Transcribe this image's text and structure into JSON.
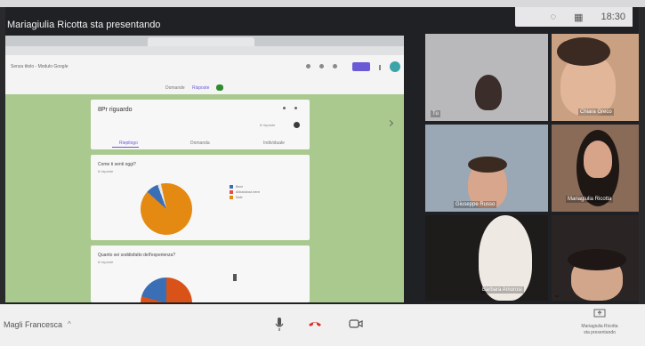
{
  "window": {
    "presenter_title": "Mariagiulia Ricotta sta presentando",
    "clock": "18:30"
  },
  "shared_screen": {
    "forms_title": "Senza titolo - Modulo Google",
    "tab_questions": "Domande",
    "tab_answers": "Risposte",
    "summary": {
      "title": "8Pr riguardo",
      "count": "8 risposte",
      "tabs": [
        "Riepilogo",
        "Domanda",
        "Individuale"
      ]
    },
    "question1": {
      "title": "Come ti senti oggi?",
      "subtitle": "8 risposte",
      "legend": [
        "Bene",
        "Abbastanza bene",
        "Male"
      ]
    },
    "question2": {
      "title": "Quanto sei soddisfatto dell'esperienza?",
      "subtitle": "8 risposte"
    },
    "colors": {
      "orange": "#e48a13",
      "blue": "#3b6fb5",
      "red": "#d95318",
      "purple": "#6a5ad6"
    }
  },
  "participants": [
    {
      "name": "Tu"
    },
    {
      "name": "Chiara Greco"
    },
    {
      "name": "Giuseppe Russo"
    },
    {
      "name": "Mariagiulia Ricotta"
    },
    {
      "name": "Barbara Amorosi"
    },
    {
      "name": ""
    }
  ],
  "callbar": {
    "self_name": "Magli Francesca",
    "present_line1": "Mariagiulia Ricotta",
    "present_line2": "sta presentando",
    "icons": {
      "mic": "mic-icon",
      "hang": "hang-up-icon",
      "cam": "camera-icon"
    }
  }
}
